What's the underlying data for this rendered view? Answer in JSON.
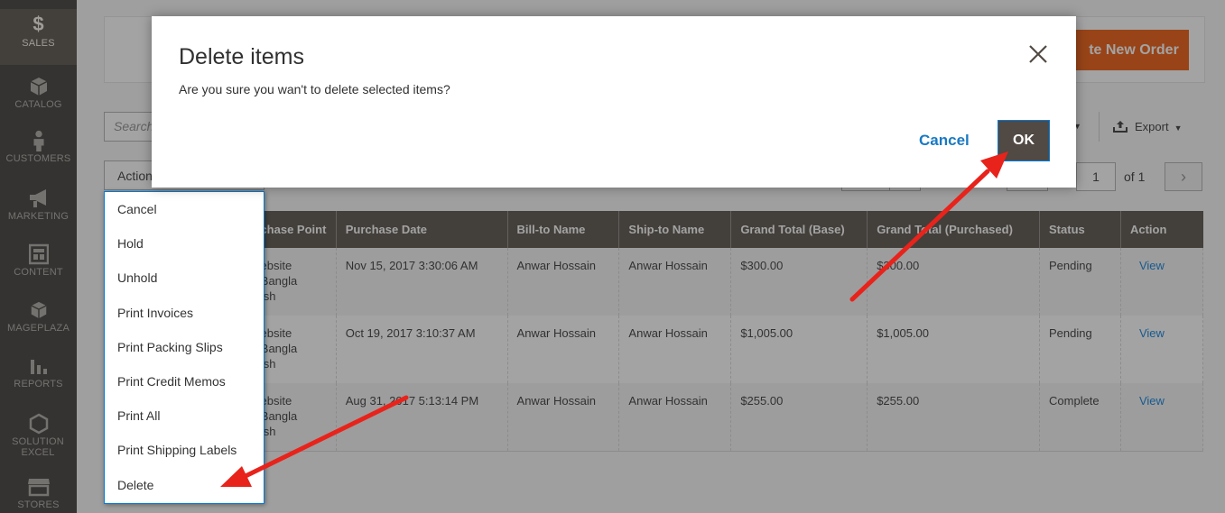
{
  "sidebar": {
    "items": [
      {
        "label": "SALES",
        "icon": "dollar-icon"
      },
      {
        "label": "CATALOG",
        "icon": "cube-icon"
      },
      {
        "label": "CUSTOMERS",
        "icon": "person-icon"
      },
      {
        "label": "MARKETING",
        "icon": "megaphone-icon"
      },
      {
        "label": "CONTENT",
        "icon": "layout-icon"
      },
      {
        "label": "MAGEPLAZA",
        "icon": "cube-icon"
      },
      {
        "label": "REPORTS",
        "icon": "bar-chart-icon"
      },
      {
        "label": "SOLUTION EXCEL",
        "icon": "hexagon-icon"
      },
      {
        "label": "STORES",
        "icon": "store-icon"
      }
    ]
  },
  "header": {
    "create_order_label": "te New Order"
  },
  "toolbar": {
    "search_placeholder": "Search",
    "export_label": "Export",
    "actions_label": "Actions",
    "pager_page": "1",
    "pager_of": "of 1"
  },
  "actions_menu": [
    "Cancel",
    "Hold",
    "Unhold",
    "Print Invoices",
    "Print Packing Slips",
    "Print Credit Memos",
    "Print All",
    "Print Shipping Labels",
    "Delete"
  ],
  "grid": {
    "columns": [
      "Purchase Point",
      "Purchase Date",
      "Bill-to Name",
      "Ship-to Name",
      "Grand Total (Base)",
      "Grand Total (Purchased)",
      "Status",
      "Action"
    ],
    "rows": [
      {
        "purchase_point": [
          "in Website",
          "rom Bangla",
          " English"
        ],
        "date": "Nov 15, 2017 3:30:06 AM",
        "bill_to": "Anwar Hossain",
        "ship_to": "Anwar Hossain",
        "total_base": "$300.00",
        "total_purchased": "$300.00",
        "status": "Pending",
        "action": "View"
      },
      {
        "purchase_point": [
          "in Website",
          "rom Bangla",
          " English"
        ],
        "date": "Oct 19, 2017 3:10:37 AM",
        "bill_to": "Anwar Hossain",
        "ship_to": "Anwar Hossain",
        "total_base": "$1,005.00",
        "total_purchased": "$1,005.00",
        "status": "Pending",
        "action": "View"
      },
      {
        "purchase_point": [
          "in Website",
          "rom Bangla",
          " English"
        ],
        "date": "Aug 31, 2017 5:13:14 PM",
        "bill_to": "Anwar Hossain",
        "ship_to": "Anwar Hossain",
        "total_base": "$255.00",
        "total_purchased": "$255.00",
        "status": "Complete",
        "action": "View"
      }
    ]
  },
  "modal": {
    "title": "Delete items",
    "message": "Are you sure you wan't to delete selected items?",
    "cancel_label": "Cancel",
    "ok_label": "OK"
  },
  "colors": {
    "sidebar_bg": "#373330",
    "accent_orange": "#eb5202",
    "table_header": "#514943",
    "link_blue": "#007bdb",
    "annotation_red": "#e8231b"
  }
}
